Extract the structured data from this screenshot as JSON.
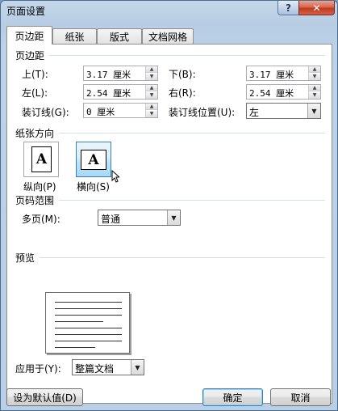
{
  "window": {
    "title": "页面设置",
    "help_label": "?",
    "close_label": "✕"
  },
  "tabs": [
    {
      "label": "页边距",
      "active": true
    },
    {
      "label": "纸张",
      "active": false
    },
    {
      "label": "版式",
      "active": false
    },
    {
      "label": "文档网格",
      "active": false
    }
  ],
  "margins": {
    "section_title": "页边距",
    "top": {
      "label": "上(T):",
      "value": "3.17 厘米"
    },
    "bottom": {
      "label": "下(B):",
      "value": "3.17 厘米"
    },
    "left": {
      "label": "左(L):",
      "value": "2.54 厘米"
    },
    "right": {
      "label": "右(R):",
      "value": "2.54 厘米"
    },
    "gutter": {
      "label": "装订线(G):",
      "value": "0 厘米"
    },
    "gutter_position": {
      "label": "装订线位置(U):",
      "value": "左"
    }
  },
  "orientation": {
    "section_title": "纸张方向",
    "glyph": "A",
    "portrait": {
      "label": "纵向(P)",
      "selected": false
    },
    "landscape": {
      "label": "横向(S)",
      "selected": true
    }
  },
  "pages": {
    "section_title": "页码范围",
    "multiple_label": "多页(M):",
    "multiple_value": "普通"
  },
  "preview": {
    "section_title": "预览"
  },
  "apply_to": {
    "label": "应用于(Y):",
    "value": "整篇文档"
  },
  "buttons": {
    "default_label": "设为默认值(D)",
    "ok_label": "确定",
    "cancel_label": "取消"
  },
  "colors": {
    "accent": "#3c7fb1",
    "close": "#c13a1d"
  },
  "icons": {
    "spin": "spin-arrows-icon",
    "drop": "chevron-down-icon",
    "pointer": "mouse-pointer-icon"
  }
}
